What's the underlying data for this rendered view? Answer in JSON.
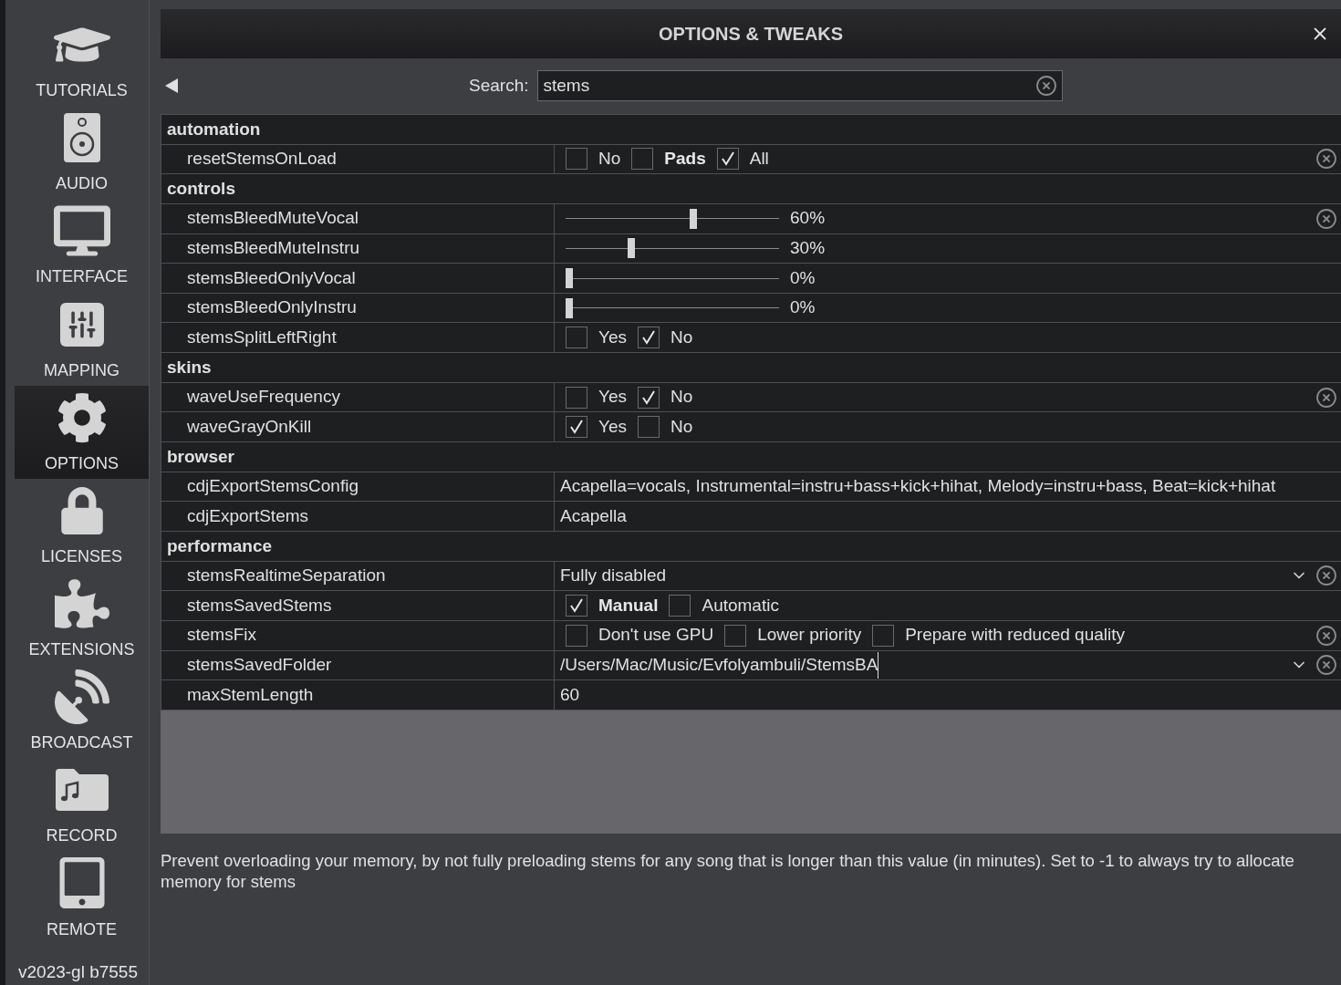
{
  "window": {
    "title": "OPTIONS & TWEAKS"
  },
  "sidebar": {
    "items": [
      {
        "label": "TUTORIALS",
        "selected": false
      },
      {
        "label": "AUDIO",
        "selected": false
      },
      {
        "label": "INTERFACE",
        "selected": false
      },
      {
        "label": "MAPPING",
        "selected": false
      },
      {
        "label": "OPTIONS",
        "selected": true
      },
      {
        "label": "LICENSES",
        "selected": false
      },
      {
        "label": "EXTENSIONS",
        "selected": false
      },
      {
        "label": "BROADCAST",
        "selected": false
      },
      {
        "label": "RECORD",
        "selected": false
      },
      {
        "label": "REMOTE",
        "selected": false
      }
    ],
    "version": "v2023-gl b7555"
  },
  "search": {
    "label": "Search:",
    "value": "stems"
  },
  "groups": [
    {
      "name": "automation",
      "rows": [
        {
          "name": "resetStemsOnLoad",
          "kind": "choices",
          "reset": true,
          "options": [
            {
              "label": "No",
              "checked": false,
              "bold": false
            },
            {
              "label": "Pads",
              "checked": false,
              "bold": true
            },
            {
              "label": "All",
              "checked": true,
              "bold": false
            }
          ]
        }
      ]
    },
    {
      "name": "controls",
      "rows": [
        {
          "name": "stemsBleedMuteVocal",
          "kind": "slider",
          "reset": true,
          "level": 0.6,
          "reading": "60%"
        },
        {
          "name": "stemsBleedMuteInstru",
          "kind": "slider",
          "reset": false,
          "level": 0.3,
          "reading": "30%"
        },
        {
          "name": "stemsBleedOnlyVocal",
          "kind": "slider",
          "reset": false,
          "level": 0,
          "reading": "0%"
        },
        {
          "name": "stemsBleedOnlyInstru",
          "kind": "slider",
          "reset": false,
          "level": 0,
          "reading": "0%"
        },
        {
          "name": "stemsSplitLeftRight",
          "kind": "choices",
          "reset": false,
          "options": [
            {
              "label": "Yes",
              "checked": false,
              "bold": false
            },
            {
              "label": "No",
              "checked": true,
              "bold": false
            }
          ]
        }
      ]
    },
    {
      "name": "skins",
      "rows": [
        {
          "name": "waveUseFrequency",
          "kind": "choices",
          "reset": true,
          "options": [
            {
              "label": "Yes",
              "checked": false,
              "bold": false
            },
            {
              "label": "No",
              "checked": true,
              "bold": false
            }
          ]
        },
        {
          "name": "waveGrayOnKill",
          "kind": "choices",
          "reset": false,
          "options": [
            {
              "label": "Yes",
              "checked": true,
              "bold": false
            },
            {
              "label": "No",
              "checked": false,
              "bold": false
            }
          ]
        }
      ]
    },
    {
      "name": "browser",
      "rows": [
        {
          "name": "cdjExportStemsConfig",
          "kind": "text",
          "reset": false,
          "editing": false,
          "value": "Acapella=vocals, Instrumental=instru+bass+kick+hihat, Melody=instru+bass, Beat=kick+hihat"
        },
        {
          "name": "cdjExportStems",
          "kind": "text",
          "reset": false,
          "editing": false,
          "value": "Acapella"
        }
      ]
    },
    {
      "name": "performance",
      "rows": [
        {
          "name": "stemsRealtimeSeparation",
          "kind": "dropdown",
          "reset": true,
          "editing": false,
          "value": "Fully disabled"
        },
        {
          "name": "stemsSavedStems",
          "kind": "choices",
          "reset": false,
          "options": [
            {
              "label": "Manual",
              "checked": true,
              "bold": true
            },
            {
              "label": "Automatic",
              "checked": false,
              "bold": false
            }
          ]
        },
        {
          "name": "stemsFix",
          "kind": "choices",
          "reset": true,
          "options": [
            {
              "label": "Don't use GPU",
              "checked": false,
              "bold": false
            },
            {
              "label": "Lower priority",
              "checked": false,
              "bold": false
            },
            {
              "label": "Prepare with reduced quality",
              "checked": false,
              "bold": false
            }
          ]
        },
        {
          "name": "stemsSavedFolder",
          "kind": "dropdown",
          "reset": true,
          "editing": true,
          "value": "/Users/Mac/Music/Evfolyambuli/StemsBA"
        },
        {
          "name": "maxStemLength",
          "kind": "text",
          "reset": false,
          "editing": false,
          "value": "60"
        }
      ]
    }
  ],
  "description": "Prevent overloading your memory, by not fully preloading stems for any song that is longer than this value (in minutes). Set to -1 to always try to allocate memory for stems"
}
